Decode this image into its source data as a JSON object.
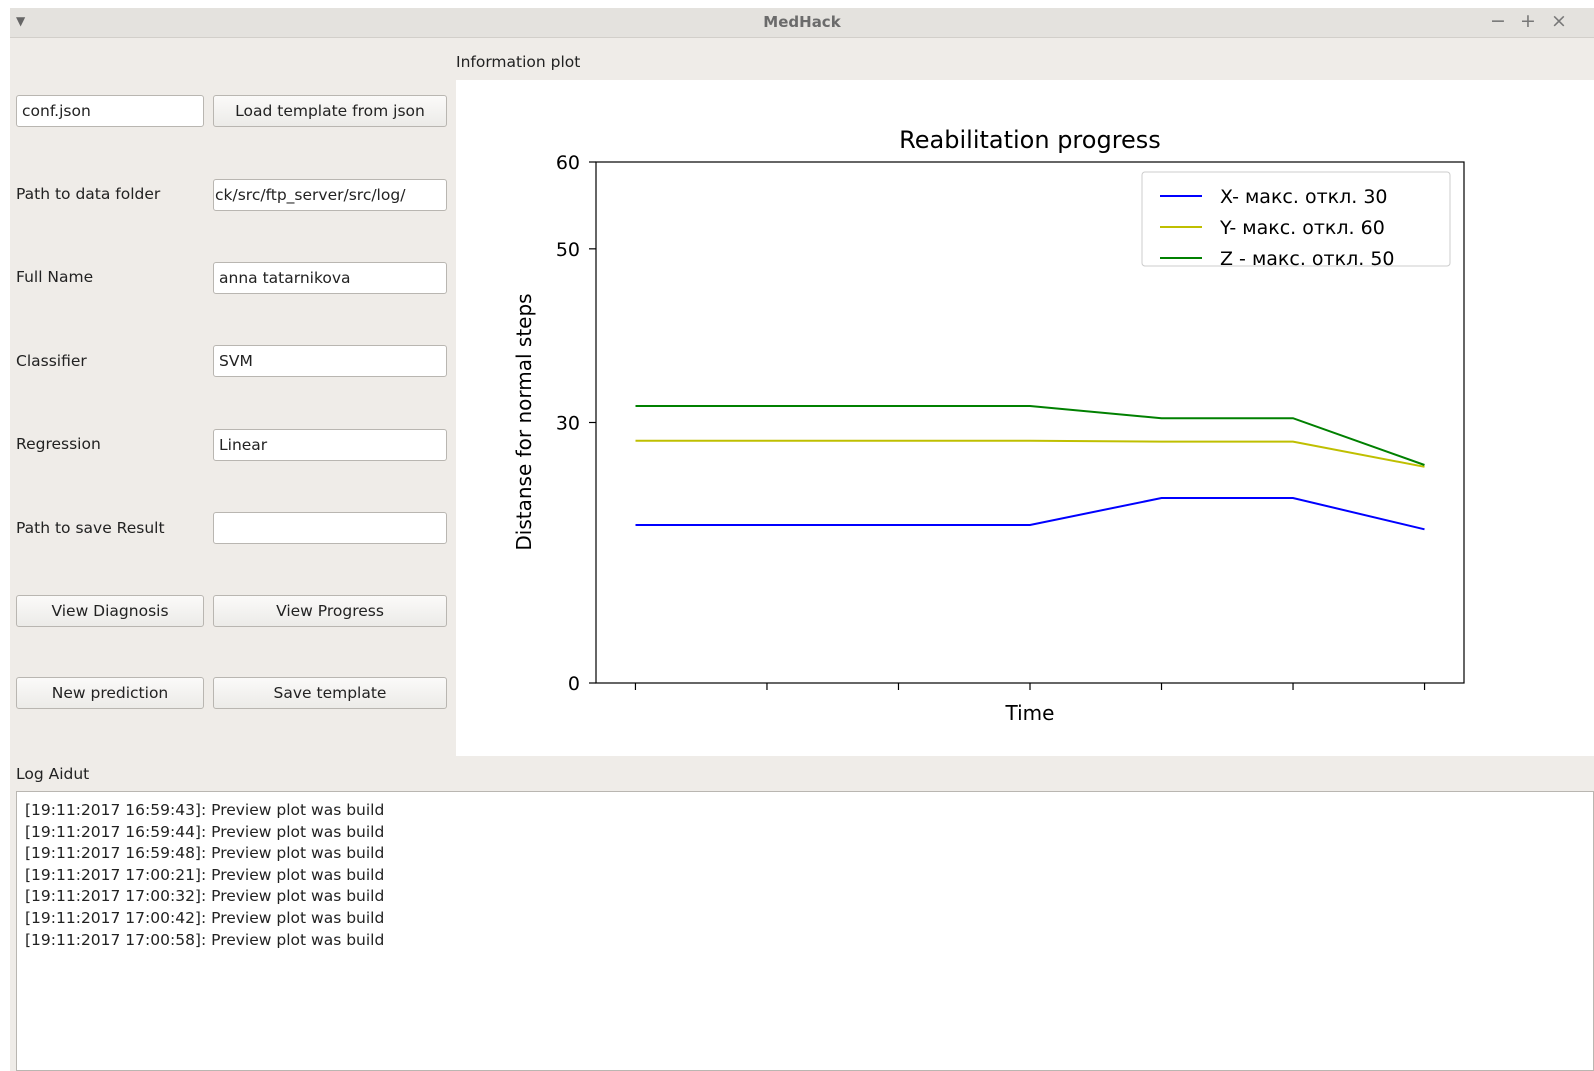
{
  "window": {
    "title": "MedHack",
    "menu_icon": "chevron-down-icon",
    "controls": {
      "minimize": "−",
      "maximize": "+",
      "close": "×"
    }
  },
  "form": {
    "template_file": {
      "value": "conf.json"
    },
    "load_template_button": "Load template from json",
    "data_folder": {
      "label": "Path to data folder",
      "value": "ck/src/ftp_server/src/log/"
    },
    "full_name": {
      "label": "Full Name",
      "value": "anna tatarnikova"
    },
    "classifier": {
      "label": "Classifier",
      "value": "SVM"
    },
    "regression": {
      "label": "Regression",
      "value": "Linear"
    },
    "save_result": {
      "label": "Path to save Result",
      "value": ""
    },
    "view_diagnosis_button": "View Diagnosis",
    "view_progress_button": "View Progress",
    "new_prediction_button": "New prediction",
    "save_template_button": "Save template"
  },
  "plot": {
    "section_label": "Information plot"
  },
  "chart_data": {
    "type": "line",
    "title": "Reabilitation progress",
    "xlabel": "Time",
    "ylabel": "Distanse for normal steps",
    "ylim": [
      0,
      60
    ],
    "yticks": [
      0,
      30,
      50,
      60
    ],
    "xlim": [
      0.7,
      7.3
    ],
    "x": [
      1,
      2,
      3,
      4,
      5,
      6,
      7
    ],
    "grid": false,
    "legend_position": "top-right",
    "series": [
      {
        "name": "X- макс. откл. 30",
        "color": "#0000ff",
        "values": [
          18.2,
          18.2,
          18.2,
          18.2,
          21.3,
          21.3,
          17.7
        ]
      },
      {
        "name": "Y- макс. откл. 60",
        "color": "#bfbf00",
        "values": [
          27.9,
          27.9,
          27.9,
          27.9,
          27.8,
          27.8,
          24.9
        ]
      },
      {
        "name": "Z - макс. откл. 50",
        "color": "#008000",
        "values": [
          31.9,
          31.9,
          31.9,
          31.9,
          30.5,
          30.5,
          25.1
        ]
      }
    ]
  },
  "log": {
    "label": "Log Aidut",
    "lines": [
      "[19:11:2017 16:59:43]: Preview plot was build",
      "[19:11:2017 16:59:44]: Preview plot was build",
      "[19:11:2017 16:59:48]: Preview plot was build",
      "[19:11:2017 17:00:21]: Preview plot was build",
      "[19:11:2017 17:00:32]: Preview plot was build",
      "[19:11:2017 17:00:42]: Preview plot was build",
      "[19:11:2017 17:00:58]: Preview plot was build"
    ]
  }
}
